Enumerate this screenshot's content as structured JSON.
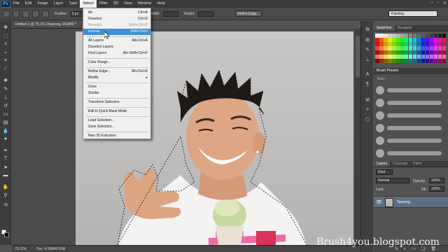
{
  "app": {
    "logo": "Ps",
    "menu": [
      "File",
      "Edit",
      "Image",
      "Layer",
      "Type",
      "Select",
      "Filter",
      "3D",
      "View",
      "Window",
      "Help"
    ],
    "active_menu": "Select",
    "window_controls": [
      "–",
      "▫",
      "✕"
    ]
  },
  "options_bar": {
    "feather_label": "Feather:",
    "feather_value": "0 px",
    "width_label": "Width:",
    "height_label": "Height:",
    "refine_edge_label": "Refine Edge...",
    "workspace": "Painting"
  },
  "document": {
    "tab_title": "Untitled-1 @ 75.1% (Taeyong, RGB/8) *",
    "zoom": "75.12%",
    "doc_size": "Doc: 4.50M/4.50M"
  },
  "select_menu": {
    "items": [
      {
        "label": "All",
        "shortcut": "Ctrl+A",
        "disabled": false,
        "highlight": false,
        "submenu": false
      },
      {
        "label": "Deselect",
        "shortcut": "Ctrl+D",
        "disabled": false,
        "highlight": false,
        "submenu": false
      },
      {
        "label": "Reselect",
        "shortcut": "Shift+Ctrl+D",
        "disabled": true,
        "highlight": false,
        "submenu": false
      },
      {
        "label": "Inverse",
        "shortcut": "Shift+Ctrl+I",
        "disabled": false,
        "highlight": true,
        "submenu": false
      },
      {
        "label": "All Layers",
        "shortcut": "Alt+Ctrl+A",
        "disabled": false,
        "highlight": false,
        "submenu": false
      },
      {
        "label": "Deselect Layers",
        "shortcut": "",
        "disabled": false,
        "highlight": false,
        "submenu": false
      },
      {
        "label": "Find Layers",
        "shortcut": "Alt+Shift+Ctrl+F",
        "disabled": false,
        "highlight": false,
        "submenu": false
      },
      {
        "label": "Color Range...",
        "shortcut": "",
        "disabled": false,
        "highlight": false,
        "submenu": false
      },
      {
        "label": "Refine Edge...",
        "shortcut": "Alt+Ctrl+R",
        "disabled": false,
        "highlight": false,
        "submenu": false
      },
      {
        "label": "Modify",
        "shortcut": "",
        "disabled": false,
        "highlight": false,
        "submenu": true
      },
      {
        "label": "Grow",
        "shortcut": "",
        "disabled": false,
        "highlight": false,
        "submenu": false
      },
      {
        "label": "Similar",
        "shortcut": "",
        "disabled": false,
        "highlight": false,
        "submenu": false
      },
      {
        "label": "Transform Selection",
        "shortcut": "",
        "disabled": false,
        "highlight": false,
        "submenu": false
      },
      {
        "label": "Edit in Quick Mask Mode",
        "shortcut": "",
        "disabled": false,
        "highlight": false,
        "submenu": false
      },
      {
        "label": "Load Selection...",
        "shortcut": "",
        "disabled": false,
        "highlight": false,
        "submenu": false
      },
      {
        "label": "Save Selection...",
        "shortcut": "",
        "disabled": false,
        "highlight": false,
        "submenu": false
      },
      {
        "label": "New 3D Extrusion",
        "shortcut": "",
        "disabled": false,
        "highlight": false,
        "submenu": false
      }
    ]
  },
  "swatches_panel": {
    "tabs": [
      "Swatches",
      "Navigator"
    ]
  },
  "brush_presets": {
    "title": "Brush Presets",
    "size_label": "Size:"
  },
  "layers_panel": {
    "tabs": [
      "Layers",
      "Channels",
      "Paths"
    ],
    "kind_label": "Kind",
    "blend_mode": "Normal",
    "opacity_label": "Opacity:",
    "opacity_value": "100%",
    "lock_label": "Lock:",
    "fill_label": "Fill:",
    "fill_value": "100%",
    "layer_name": "Taeyong",
    "bottom_icons": [
      "fx",
      "◐",
      "▭",
      "❑",
      "🗑"
    ]
  },
  "watermark": "Brush4you.blogspot.com",
  "colors": {
    "accent": "#3f8fd8",
    "menu_bg": "#f0f0f0",
    "ui_dark": "#3a3a3a",
    "canvas_bg": "#c2c1bf"
  }
}
